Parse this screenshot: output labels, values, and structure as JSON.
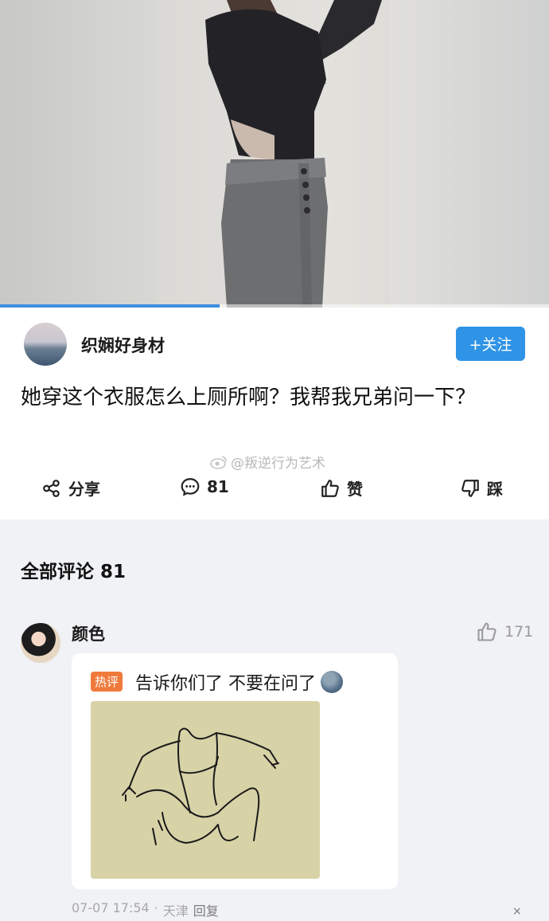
{
  "media": {
    "progress_percent": 40
  },
  "post": {
    "author": "织娴好身材",
    "follow_label": "+关注",
    "text": "她穿这个衣服怎么上厕所啊？我帮我兄弟问一下？",
    "watermark": "@叛逆行为艺术",
    "actions": {
      "share": "分享",
      "comments": "81",
      "like": "赞",
      "dislike": "踩"
    }
  },
  "comments": {
    "title": "全部评论 81",
    "items": [
      {
        "name": "颜色",
        "likes": "171",
        "hot_tag": "热评",
        "text": "告诉你们了 不要在问了",
        "date": "07-07 17:54",
        "location": "天津",
        "reply_label": "回复",
        "close": "×"
      }
    ]
  },
  "colors": {
    "accent": "#2f93e6",
    "hot_tag": "#f07a3b",
    "progress": "#3d8fe0"
  }
}
